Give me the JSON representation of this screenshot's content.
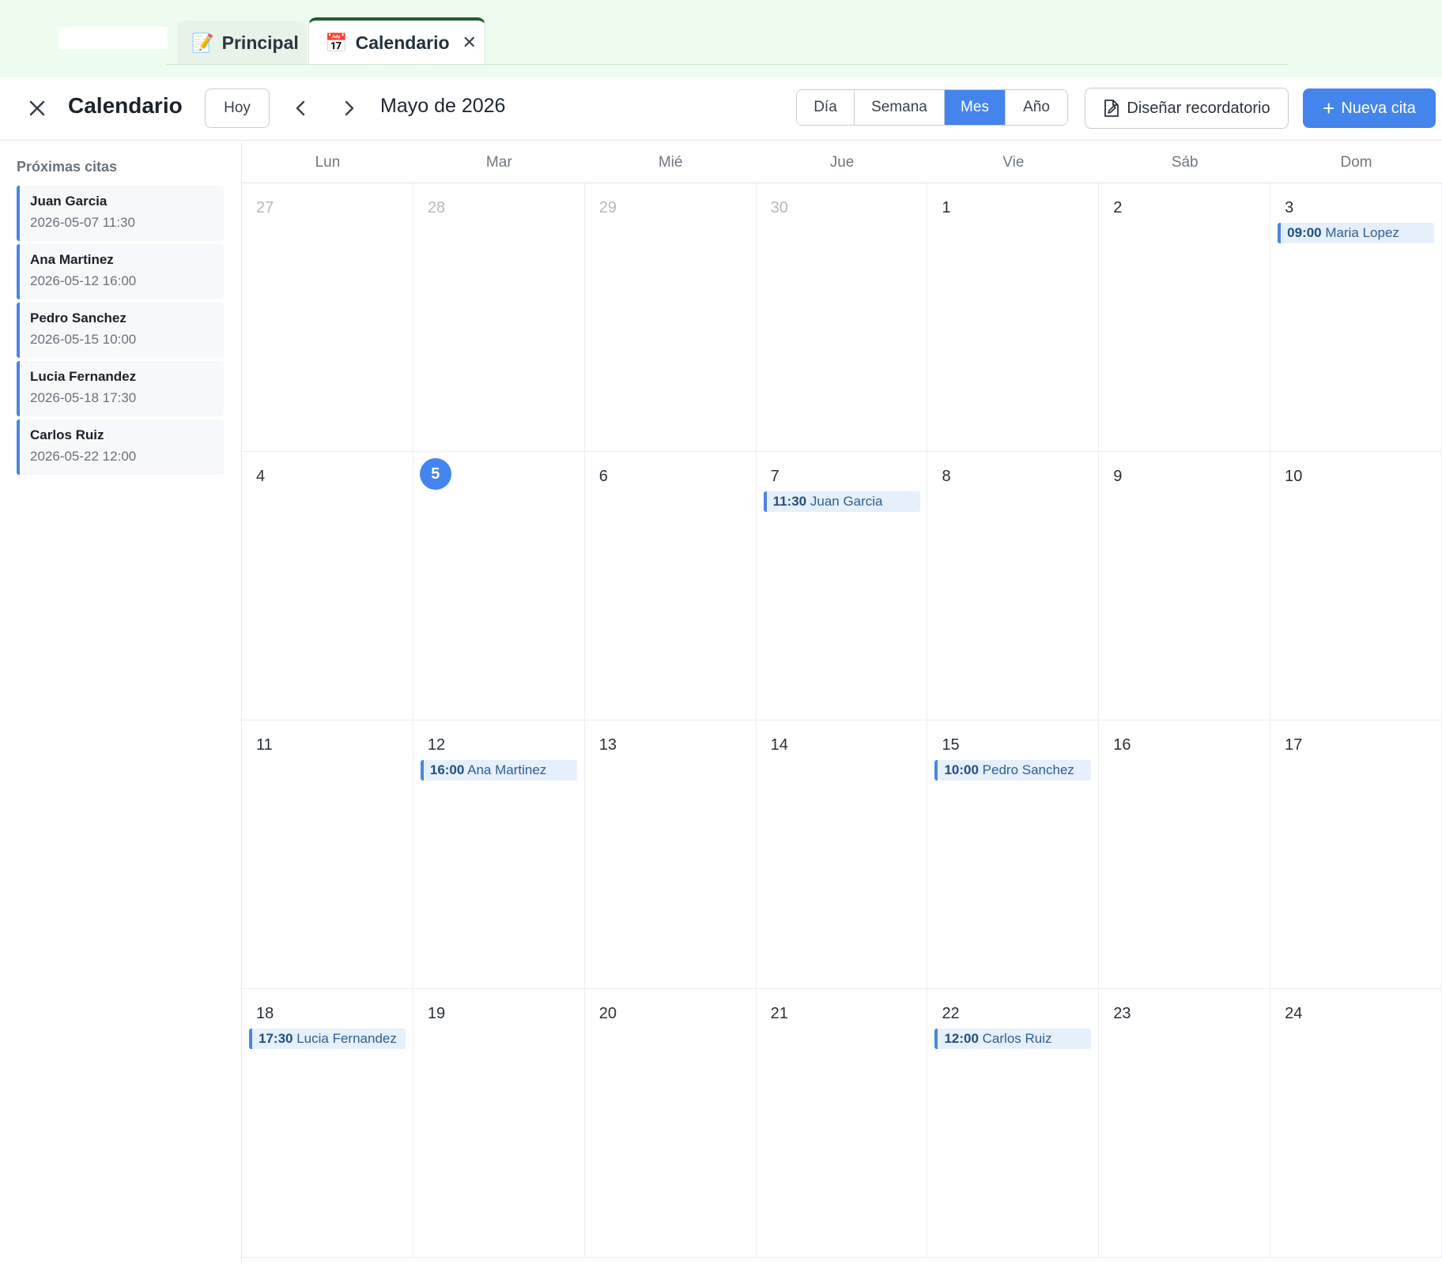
{
  "tabs": [
    {
      "emoji": "📝",
      "label": "Principal"
    },
    {
      "emoji": "📅",
      "label": "Calendario",
      "close": "✕"
    }
  ],
  "toolbar": {
    "title": "Calendario",
    "today_label": "Hoy",
    "month_label": "Mayo de 2026",
    "views": [
      "Día",
      "Semana",
      "Mes",
      "Año"
    ],
    "active_view": "Mes",
    "design_label": "Diseñar recordatorio",
    "new_label": "Nueva cita",
    "accent_color": "#4385ed"
  },
  "sidebar": {
    "title": "Próximas citas",
    "items": [
      {
        "name": "Juan Garcia",
        "date": "2026-05-07 11:30"
      },
      {
        "name": "Ana Martinez",
        "date": "2026-05-12 16:00"
      },
      {
        "name": "Pedro Sanchez",
        "date": "2026-05-15 10:00"
      },
      {
        "name": "Lucia Fernandez",
        "date": "2026-05-18 17:30"
      },
      {
        "name": "Carlos Ruiz",
        "date": "2026-05-22 12:00"
      }
    ]
  },
  "calendar": {
    "weekdays": [
      "Lun",
      "Mar",
      "Mié",
      "Jue",
      "Vie",
      "Sáb",
      "Dom"
    ],
    "today": 5,
    "weeks": [
      [
        {
          "day": "27",
          "other": true
        },
        {
          "day": "28",
          "other": true
        },
        {
          "day": "29",
          "other": true
        },
        {
          "day": "30",
          "other": true
        },
        {
          "day": "1"
        },
        {
          "day": "2"
        },
        {
          "day": "3",
          "event": {
            "time": "09:00",
            "name": "Maria Lopez"
          }
        }
      ],
      [
        {
          "day": "4"
        },
        {
          "day": "5",
          "today": true
        },
        {
          "day": "6"
        },
        {
          "day": "7",
          "event": {
            "time": "11:30",
            "name": "Juan Garcia"
          }
        },
        {
          "day": "8"
        },
        {
          "day": "9"
        },
        {
          "day": "10"
        }
      ],
      [
        {
          "day": "11"
        },
        {
          "day": "12",
          "event": {
            "time": "16:00",
            "name": "Ana Martinez"
          }
        },
        {
          "day": "13"
        },
        {
          "day": "14"
        },
        {
          "day": "15",
          "event": {
            "time": "10:00",
            "name": "Pedro Sanchez"
          }
        },
        {
          "day": "16"
        },
        {
          "day": "17"
        }
      ],
      [
        {
          "day": "18",
          "event": {
            "time": "17:30",
            "name": "Lucia Fernandez"
          }
        },
        {
          "day": "19"
        },
        {
          "day": "20"
        },
        {
          "day": "21"
        },
        {
          "day": "22",
          "event": {
            "time": "12:00",
            "name": "Carlos Ruiz"
          }
        },
        {
          "day": "23"
        },
        {
          "day": "24"
        }
      ]
    ]
  }
}
